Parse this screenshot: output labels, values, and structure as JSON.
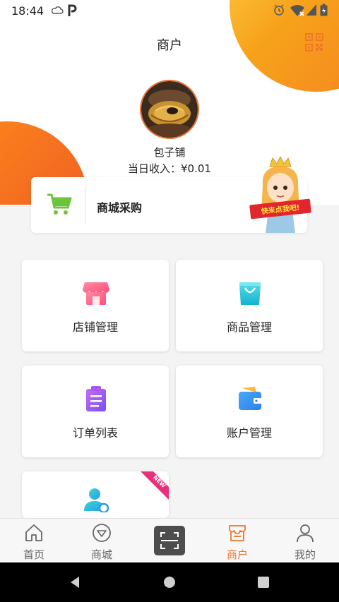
{
  "status_bar": {
    "time": "18:44",
    "left_icons": [
      "cloud-icon",
      "p-icon"
    ],
    "right_icons": [
      "alarm-icon",
      "wifi-icon",
      "signal-icon",
      "battery-icon"
    ]
  },
  "header": {
    "title": "商户",
    "qr_icon": "qr-code-icon"
  },
  "profile": {
    "shop_name": "包子铺",
    "income_label": "当日收入：¥0.01"
  },
  "mall_card": {
    "label": "商城采购",
    "icon": "cart-icon",
    "badge_text": "快来点我吧!"
  },
  "tiles": [
    {
      "label": "店铺管理",
      "icon": "store-icon"
    },
    {
      "label": "商品管理",
      "icon": "bag-icon"
    },
    {
      "label": "订单列表",
      "icon": "clipboard-icon"
    },
    {
      "label": "账户管理",
      "icon": "wallet-icon"
    },
    {
      "label": "",
      "icon": "user-settings-icon",
      "ribbon": "NEW"
    }
  ],
  "bottom_nav": {
    "items": [
      {
        "label": "首页",
        "icon": "home-icon"
      },
      {
        "label": "商城",
        "icon": "mall-icon"
      },
      {
        "label": "",
        "icon": "scan-icon"
      },
      {
        "label": "商户",
        "icon": "merchant-icon",
        "active": true
      },
      {
        "label": "我的",
        "icon": "profile-icon"
      }
    ]
  },
  "colors": {
    "accent": "#e8772e",
    "orange_blob": "#f36a21",
    "yellow_blob": "#f7a21b",
    "cart_green": "#6cc43a",
    "scan_bg": "#4d4d4d"
  }
}
